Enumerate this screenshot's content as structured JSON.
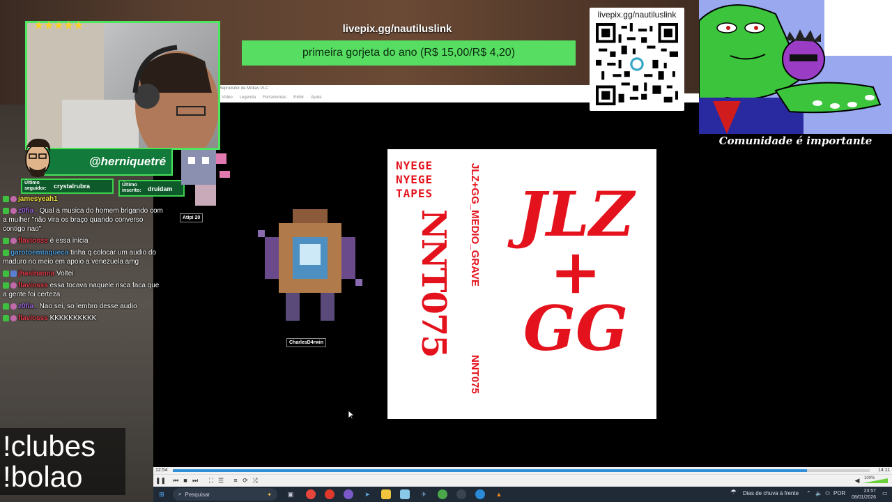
{
  "donation": {
    "url": "livepix.gg/nautiluslink",
    "message": "primeira gorjeta do ano (R$ 15,00/R$ 4,20)"
  },
  "qr": {
    "title": "livepix.gg/nautiluslink"
  },
  "comic": {
    "caption": "Comunidade é importante"
  },
  "webcam": {
    "stars": "★★★★★"
  },
  "twitter": {
    "handle": "@herniquetré"
  },
  "last_follower": {
    "label": "Último seguidor:",
    "name": "crystalrubra"
  },
  "last_sub": {
    "label": "Último inscrito:",
    "name": "druidam"
  },
  "chat": [
    {
      "user": "jamesyeah1",
      "color": "#f0e040",
      "text": ""
    },
    {
      "user": "z0fia_",
      "color": "#9a63d8",
      "text": "Qual a musica do homem brigando com a mulher \"não vira os braço quando converso contigo nao\""
    },
    {
      "user": "flaviosss",
      "color": "#e03a4a",
      "text": "é essa inicia"
    },
    {
      "user": "garotoemtaqueca",
      "color": "#4a9ad8",
      "text": "tinha q colocar um audio do maduro no meio em apoio a venezuela amg"
    },
    {
      "user": "jhasinanna",
      "color": "#e03a4a",
      "text": "Voltei"
    },
    {
      "user": "flaviosss",
      "color": "#e03a4a",
      "text": "essa tocava naquele risca faca que a gente foi certeza"
    },
    {
      "user": "z0fia_",
      "color": "#9a63d8",
      "text": "Nao sei, so lembro desse audio"
    },
    {
      "user": "flaviosss",
      "color": "#e03a4a",
      "text": "KKKKKKKKKK"
    }
  ],
  "commands": {
    "line1": "!clubes",
    "line2": "!bolao"
  },
  "sprites": {
    "ghost": "Atipi 20",
    "bug": "CharlesD4rwin"
  },
  "vlc": {
    "title": "Reprodutor de Mídias VLC",
    "menu": [
      "Vídeo",
      "Legenda",
      "Ferramentas",
      "Exibir",
      "Ajuda"
    ],
    "time_elapsed": "12:54",
    "time_total": "14:11",
    "progress": 0.91,
    "volume": "100%"
  },
  "album": {
    "cover_title_lines": [
      "JLZ",
      "+",
      "GG"
    ],
    "spine_text": "JLZ+GG_MEDIO_GRAVE",
    "catalog": "NNT075",
    "label_lines": [
      "NYEGE",
      "NYEGE",
      "TAPES"
    ],
    "big_catalog": "NNT075"
  },
  "taskbar": {
    "search_placeholder": "Pesquisar",
    "weather": "Dias de chuva à frente",
    "lang": "POR",
    "time": "23:57",
    "date": "08/01/2026"
  }
}
